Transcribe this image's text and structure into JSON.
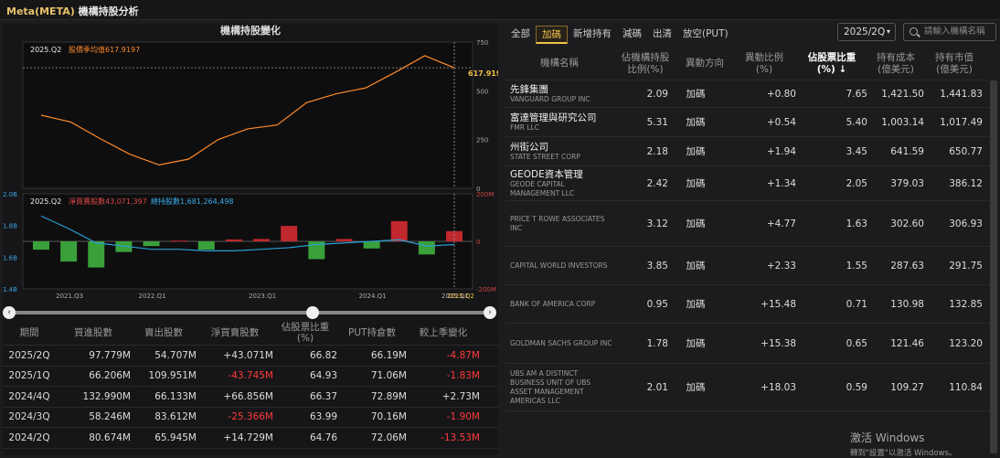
{
  "app_title": {
    "ticker": "Meta(META)",
    "subtitle": "機構持股分析"
  },
  "left_panel": {
    "title": "機構持股變化",
    "chart_data": [
      {
        "type": "line",
        "period_tag": "2025.Q2",
        "legend": "股價季均值617.9197",
        "series": [
          {
            "name": "股價季均值",
            "values": [
              375,
              340,
              255,
              175,
              120,
              150,
              250,
              305,
              325,
              440,
              485,
              515,
              595,
              680,
              618
            ]
          }
        ],
        "last_value_label": "617.9197",
        "y_ticks": [
          "750",
          "500",
          "250",
          "0"
        ],
        "ylim": [
          0,
          750
        ]
      },
      {
        "type": "bar",
        "period_tag": "2025.Q2",
        "legend_net": "淨買賣股數43,071,397",
        "legend_total": "總持股數1,681,264,498",
        "series": [
          {
            "name": "淨買賣股數",
            "values": [
              -35,
              -85,
              -110,
              -45,
              -20,
              3,
              -35,
              8,
              10,
              65,
              -75,
              10,
              -30,
              85,
              -55,
              43
            ]
          },
          {
            "name": "總持股數",
            "values": [
              1.86,
              1.78,
              1.69,
              1.67,
              1.65,
              1.65,
              1.64,
              1.64,
              1.65,
              1.66,
              1.68,
              1.69,
              1.7,
              1.71,
              1.67,
              1.68
            ]
          }
        ],
        "y_left_ticks": [
          "2.0B",
          "1.8B",
          "1.6B",
          "1.4B"
        ],
        "y_right_ticks": [
          "200M",
          "0",
          "-200M"
        ],
        "x_ticks": [
          "2021.Q3",
          "2022.Q1",
          "2023.Q1",
          "2024.Q1",
          "2025.Q1"
        ],
        "x_highlight": "2025.Q2"
      }
    ],
    "table": {
      "headers": [
        "期間",
        "買進股數",
        "賣出股數",
        "淨買賣股數",
        "佔股票比重(%)",
        "PUT持倉數",
        "較上季變化"
      ],
      "rows": [
        [
          "2025/2Q",
          "97.779M",
          "54.707M",
          "+43.071M",
          "66.82",
          "66.19M",
          "-4.87M"
        ],
        [
          "2025/1Q",
          "66.206M",
          "109.951M",
          "-43.745M",
          "64.93",
          "71.06M",
          "-1.83M"
        ],
        [
          "2024/4Q",
          "132.990M",
          "66.133M",
          "+66.856M",
          "66.37",
          "72.89M",
          "+2.73M"
        ],
        [
          "2024/3Q",
          "58.246M",
          "83.612M",
          "-25.366M",
          "63.99",
          "70.16M",
          "-1.90M"
        ],
        [
          "2024/2Q",
          "80.674M",
          "65.945M",
          "+14.729M",
          "64.76",
          "72.06M",
          "-13.53M"
        ]
      ]
    }
  },
  "right_panel": {
    "tabs": [
      "全部",
      "加碼",
      "新增持有",
      "減碼",
      "出清",
      "放空(PUT)"
    ],
    "active_tab": "加碼",
    "period_select": "2025/2Q",
    "search_placeholder": "請輸入機構名稱",
    "headers": [
      "機構名稱",
      "佔機構持股比例(%)",
      "異動方向",
      "異動比例(%)",
      "佔股票比重(%)",
      "持有成本(億美元)",
      "持有市值(億美元)"
    ],
    "rows": [
      {
        "cn": "先鋒集團",
        "en": "VANGUARD GROUP INC",
        "pct": "2.09",
        "dir": "加碼",
        "chg": "+0.80",
        "share": "7.65",
        "cost": "1,421.50",
        "value": "1,441.83"
      },
      {
        "cn": "富達管理與研究公司",
        "en": "FMR LLC",
        "pct": "5.31",
        "dir": "加碼",
        "chg": "+0.54",
        "share": "5.40",
        "cost": "1,003.14",
        "value": "1,017.49"
      },
      {
        "cn": "州街公司",
        "en": "STATE STREET CORP",
        "pct": "2.18",
        "dir": "加碼",
        "chg": "+1.94",
        "share": "3.45",
        "cost": "641.59",
        "value": "650.77"
      },
      {
        "cn": "GEODE資本管理",
        "en": "GEODE CAPITAL MANAGEMENT LLC",
        "pct": "2.42",
        "dir": "加碼",
        "chg": "+1.34",
        "share": "2.05",
        "cost": "379.03",
        "value": "386.12"
      },
      {
        "cn": "",
        "en": "PRICE T ROWE ASSOCIATES INC",
        "pct": "3.12",
        "dir": "加碼",
        "chg": "+4.77",
        "share": "1.63",
        "cost": "302.60",
        "value": "306.93"
      },
      {
        "cn": "",
        "en": "CAPITAL WORLD INVESTORS",
        "pct": "3.85",
        "dir": "加碼",
        "chg": "+2.33",
        "share": "1.55",
        "cost": "287.63",
        "value": "291.75"
      },
      {
        "cn": "",
        "en": "BANK OF AMERICA CORP",
        "pct": "0.95",
        "dir": "加碼",
        "chg": "+15.48",
        "share": "0.71",
        "cost": "130.98",
        "value": "132.85"
      },
      {
        "cn": "",
        "en": "GOLDMAN SACHS GROUP INC",
        "pct": "1.78",
        "dir": "加碼",
        "chg": "+15.38",
        "share": "0.65",
        "cost": "121.46",
        "value": "123.20"
      },
      {
        "cn": "",
        "en": "UBS AM A DISTINCT BUSINESS UNIT OF UBS ASSET MANAGEMENT AMERICAS LLC",
        "pct": "2.01",
        "dir": "加碼",
        "chg": "+18.03",
        "share": "0.59",
        "cost": "109.27",
        "value": "110.84"
      }
    ]
  },
  "watermark": {
    "title": "激活 Windows",
    "sub": "轉到\"設置\"以激活 Windows。"
  },
  "colors": {
    "accent": "#f2c04a",
    "line": "#ff8a2a",
    "up_bar": "#c0282d",
    "down_bar": "#3aa03a",
    "total_line": "#2a9fd6",
    "negative_text": "#ff3b3b"
  }
}
